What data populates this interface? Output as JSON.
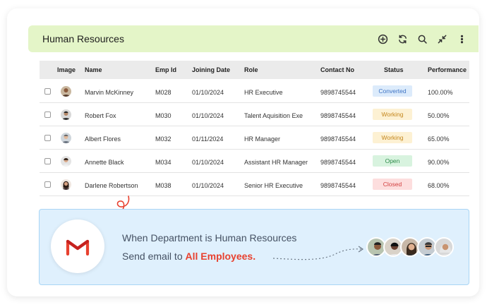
{
  "header": {
    "title": "Human Resources",
    "tools": [
      "add-circle-icon",
      "refresh-icon",
      "search-icon",
      "collapse-icon",
      "more-vertical-icon"
    ]
  },
  "table": {
    "columns": [
      "Image",
      "Name",
      "Emp Id",
      "Joining Date",
      "Role",
      "Contact No",
      "Status",
      "Performance"
    ],
    "rows": [
      {
        "name": "Marvin McKinney",
        "emp_id": "M028",
        "joining_date": "01/10/2024",
        "role": "HR Executive",
        "contact": "9898745544",
        "status": "Converted",
        "performance": "100.00%"
      },
      {
        "name": "Robert Fox",
        "emp_id": "M030",
        "joining_date": "01/10/2024",
        "role": "Talent Aquisition Exe",
        "contact": "9898745544",
        "status": "Working",
        "performance": "50.00%"
      },
      {
        "name": "Albert Flores",
        "emp_id": "M032",
        "joining_date": "01/11/2024",
        "role": "HR Manager",
        "contact": "9898745544",
        "status": "Working",
        "performance": "65.00%"
      },
      {
        "name": "Annette Black",
        "emp_id": "M034",
        "joining_date": "01/10/2024",
        "role": "Assistant HR Manager",
        "contact": "9898745544",
        "status": "Open",
        "performance": "90.00%"
      },
      {
        "name": "Darlene Robertson",
        "emp_id": "M038",
        "joining_date": "01/10/2024",
        "role": "Senior HR Executive",
        "contact": "9898745544",
        "status": "Closed",
        "performance": "68.00%"
      }
    ]
  },
  "status_colors": {
    "Converted": {
      "bg": "#dcebfb",
      "fg": "#3f74c4"
    },
    "Working": {
      "bg": "#fdf1d3",
      "fg": "#c4861c"
    },
    "Open": {
      "bg": "#d8f3df",
      "fg": "#2e8b4a"
    },
    "Closed": {
      "bg": "#fddede",
      "fg": "#d24040"
    }
  },
  "banner": {
    "line1": "When Department is Human Resources",
    "line2_prefix": "Send email to ",
    "line2_highlight": "All Employees.",
    "icon": "gmail-icon"
  },
  "colors": {
    "header_bg": "#e4f5c8",
    "banner_bg": "#dff0fd",
    "accent_red": "#e8412f"
  }
}
